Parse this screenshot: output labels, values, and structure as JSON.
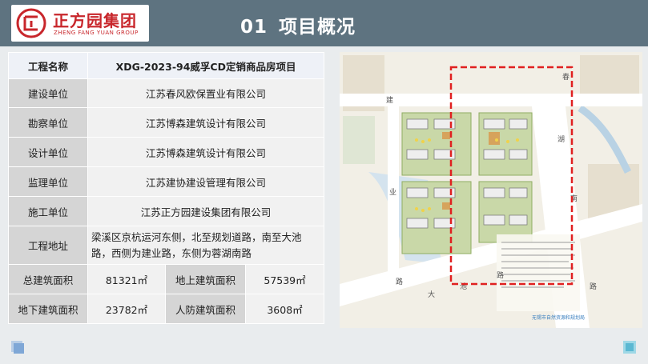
{
  "brand": {
    "name_cn": "正方园集团",
    "name_en": "ZHENG FANG YUAN GROUP",
    "color": "#c8262b"
  },
  "title": {
    "number": "01",
    "text": "项目概况"
  },
  "project_table": {
    "header": {
      "label": "工程名称",
      "value": "XDG-2023-94威孚CD定销商品房项目"
    },
    "rows": [
      {
        "label": "建设单位",
        "value": "江苏春风欧保置业有限公司"
      },
      {
        "label": "勘察单位",
        "value": "江苏博森建筑设计有限公司"
      },
      {
        "label": "设计单位",
        "value": "江苏博森建筑设计有限公司"
      },
      {
        "label": "监理单位",
        "value": "江苏建协建设管理有限公司"
      },
      {
        "label": "施工单位",
        "value": "江苏正方园建设集团有限公司"
      },
      {
        "label": "工程地址",
        "value": "梁溪区京杭运河东侧，北至规划道路，南至大池路，西侧为建业路，东侧为蓉湖南路"
      }
    ],
    "areas": [
      {
        "label1": "总建筑面积",
        "value1": "81321㎡",
        "label2": "地上建筑面积",
        "value2": "57539㎡"
      },
      {
        "label1": "地下建筑面积",
        "value1": "23782㎡",
        "label2": "人防建筑面积",
        "value2": "3608㎡"
      }
    ]
  },
  "site_plan": {
    "road_labels": [
      "建",
      "业",
      "路",
      "春",
      "湖",
      "南",
      "路",
      "大",
      "池",
      "路"
    ],
    "caption": "无锡市自然资源和规划局"
  },
  "colors": {
    "header_bg": "#5e7380",
    "content_bg": "#e9ecee",
    "highlight_frame": "#e02020"
  }
}
